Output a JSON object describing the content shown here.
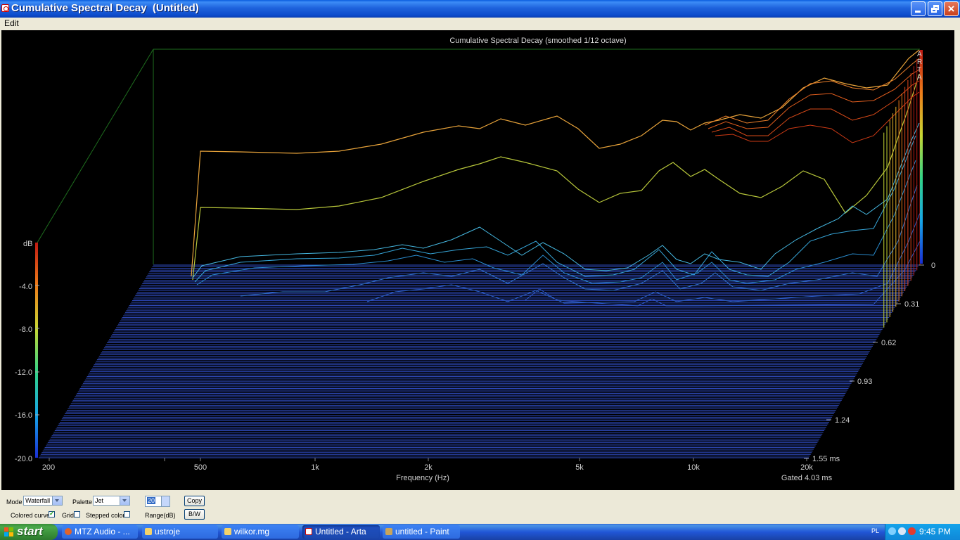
{
  "window": {
    "title": "Cumulative Spectral Decay  (Untitled)",
    "icons": [
      "arta-app-icon",
      "minimize-icon",
      "maximize-icon",
      "close-icon"
    ]
  },
  "menu": {
    "items": [
      "Edit"
    ]
  },
  "plot": {
    "title": "Cumulative Spectral Decay (smoothed 1/12 octave)",
    "watermark": "ARTA",
    "db_label": "dB",
    "db_ticks": [
      "-4.0",
      "-8.0",
      "-12.0",
      "-16.0",
      "-20.0"
    ],
    "freq_ticks": [
      "200",
      "500",
      "1k",
      "2k",
      "5k",
      "10k",
      "20k"
    ],
    "freq_label": "Frequency (Hz)",
    "time_ticks": [
      "0",
      "0.31",
      "0.62",
      "0.93",
      "1.24",
      "1.55 ms"
    ],
    "gated_label": "Gated 4.03 ms",
    "colors": {
      "floor": "#3250c8",
      "frame": "#1e6e1e",
      "background": "#000000"
    }
  },
  "controls": {
    "mode_label": "Mode",
    "mode_value": "Waterfall",
    "palette_label": "Palette",
    "palette_value": "Jet",
    "range_value": "20",
    "range_label": "Range(dB)",
    "copy_label": "Copy",
    "bw_label": "B/W",
    "colored_curves_label": "Colored curves",
    "colored_curves_checked": true,
    "grid_label": "Grid",
    "grid_checked": false,
    "stepped_colors_label": "Stepped colors",
    "stepped_colors_checked": false
  },
  "taskbar": {
    "start_label": "start",
    "tasks": [
      {
        "label": "MTZ Audio - ...",
        "icon": "firefox-icon",
        "active": false
      },
      {
        "label": "ustroje",
        "icon": "folder-icon",
        "active": false
      },
      {
        "label": "wilkor.mg",
        "icon": "folder-icon",
        "active": false
      },
      {
        "label": "Untitled - Arta",
        "icon": "arta-icon",
        "active": true
      },
      {
        "label": "untitled - Paint",
        "icon": "paint-icon",
        "active": false
      }
    ],
    "tray_lang": "PL",
    "clock": "9:45 PM"
  }
}
